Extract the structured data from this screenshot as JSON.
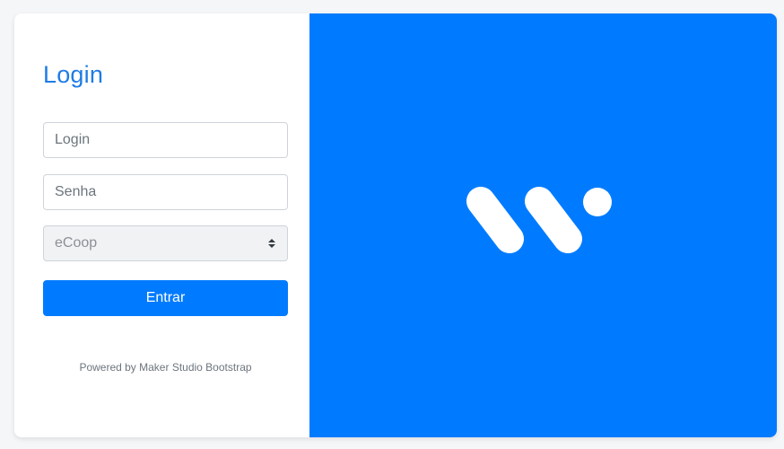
{
  "login": {
    "title": "Login",
    "username_placeholder": "Login",
    "password_placeholder": "Senha",
    "select_value": "eCoop",
    "submit_label": "Entrar",
    "footer_text": "Powered by Maker Studio Bootstrap"
  },
  "brand": {
    "logo_icon": "brand-logo-icon",
    "panel_color": "#007bff"
  },
  "colors": {
    "accent": "#007bff",
    "title": "#1e7ce6",
    "background": "#f5f6f8"
  }
}
